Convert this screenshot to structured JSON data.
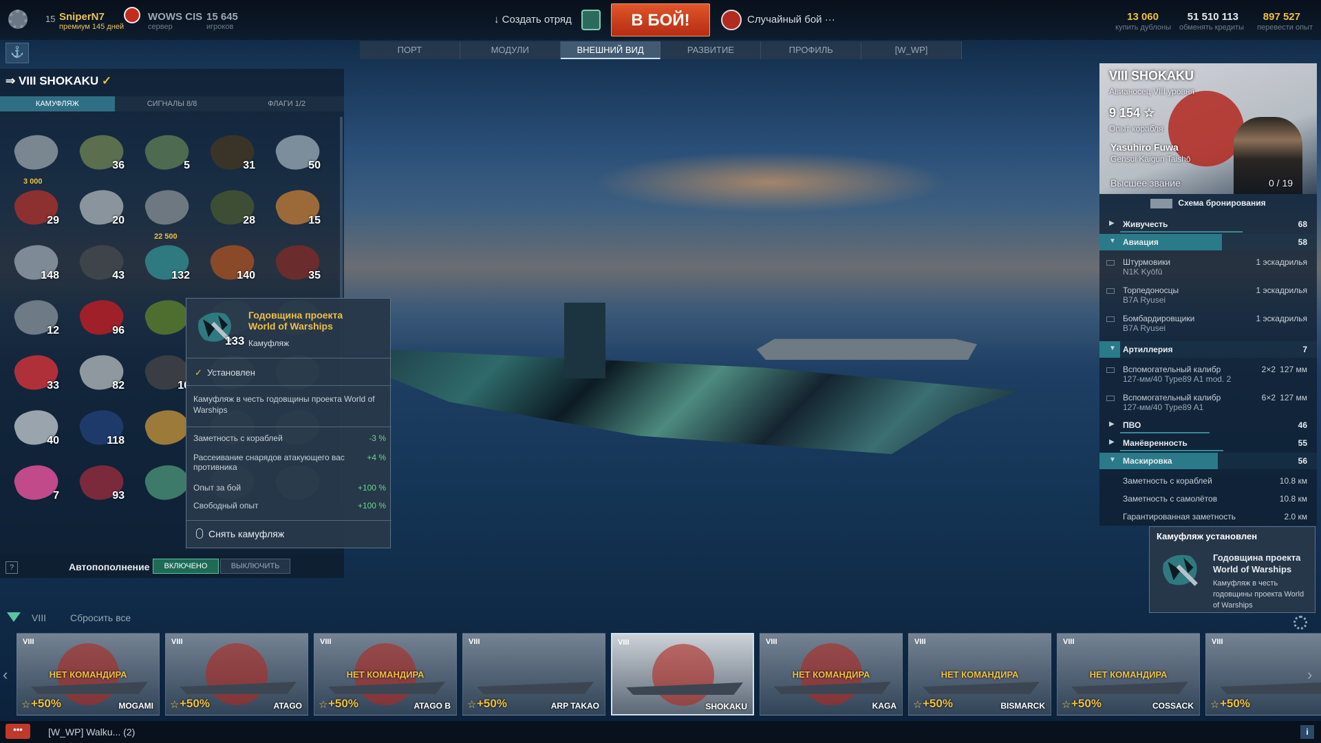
{
  "topbar": {
    "level": "15",
    "nickname": "SniperN7",
    "premium": "премиум 145 дней",
    "server": "WOWS CIS",
    "server_label": "сервер",
    "players": "15 645",
    "players_label": "игроков",
    "create_squad": "↓ Создать отряд",
    "battle": "В БОЙ!",
    "mode": "Случайный бой ···",
    "doubloons": "13 060",
    "doubloons_label": "купить дублоны",
    "credits": "51 510 113",
    "credits_label": "обменять кредиты",
    "free_xp": "897 527",
    "free_xp_label": "перевести опыт"
  },
  "nav": {
    "tabs": [
      "ПОРТ",
      "МОДУЛИ",
      "ВНЕШНИЙ ВИД",
      "РАЗВИТИЕ",
      "ПРОФИЛЬ",
      "[W_WP]"
    ],
    "active": 2
  },
  "left_panel": {
    "ship": "VIII SHOKAKU",
    "tabs": [
      "КАМУФЛЯЖ",
      "СИГНАЛЫ 8/8",
      "ФЛАГИ 1/2"
    ],
    "camos": [
      {
        "count": "",
        "price": "3 000",
        "color": "#7a8690"
      },
      {
        "count": "36",
        "price": "",
        "color": "#5b6e4e"
      },
      {
        "count": "5",
        "price": "",
        "color": "#4e6a50"
      },
      {
        "count": "31",
        "price": "",
        "color": "#3a3428"
      },
      {
        "count": "50",
        "price": "",
        "color": "#7c8e9c"
      },
      {
        "count": "29",
        "price": "",
        "color": "#8c3030"
      },
      {
        "count": "20",
        "price": "",
        "color": "#8a949c"
      },
      {
        "count": "",
        "price": "22 500",
        "color": "#6e7880"
      },
      {
        "count": "28",
        "price": "",
        "color": "#3e4e34"
      },
      {
        "count": "15",
        "price": "",
        "color": "#9c6a38"
      },
      {
        "count": "148",
        "price": "",
        "color": "#7e8a96"
      },
      {
        "count": "43",
        "price": "",
        "color": "#3e444a"
      },
      {
        "count": "132",
        "price": "",
        "color": "#2e7a80"
      },
      {
        "count": "140",
        "price": "",
        "color": "#8a4a2a"
      },
      {
        "count": "35",
        "price": "",
        "color": "#6a2c2c"
      },
      {
        "count": "12",
        "price": "",
        "color": "#6e7a86"
      },
      {
        "count": "96",
        "price": "",
        "color": "#a0202a"
      },
      {
        "count": "",
        "price": "",
        "color": "#4e6e30"
      },
      {
        "count": "",
        "price": "",
        "color": "#6e7a86"
      },
      {
        "count": "",
        "price": "",
        "color": "#6e7a86"
      },
      {
        "count": "33",
        "price": "",
        "color": "#b0303a"
      },
      {
        "count": "82",
        "price": "",
        "color": "#8e989e"
      },
      {
        "count": "10",
        "price": "",
        "color": "#3a3e44"
      },
      {
        "count": "",
        "price": "",
        "color": "#6e7a86"
      },
      {
        "count": "",
        "price": "",
        "color": "#6e7a86"
      },
      {
        "count": "40",
        "price": "",
        "color": "#9aa4ac"
      },
      {
        "count": "118",
        "price": "",
        "color": "#1e3a6a"
      },
      {
        "count": "",
        "price": "",
        "color": "#9c7a3a"
      },
      {
        "count": "",
        "price": "",
        "color": "#6e7a86"
      },
      {
        "count": "",
        "price": "",
        "color": "#6e7a86"
      },
      {
        "count": "7",
        "price": "",
        "color": "#c04a8a"
      },
      {
        "count": "93",
        "price": "",
        "color": "#7a2a3a"
      },
      {
        "count": "",
        "price": "",
        "color": "#3e7a6a"
      },
      {
        "count": "",
        "price": "",
        "color": "#6e7a86"
      },
      {
        "count": "",
        "price": "",
        "color": "#6e7a86"
      }
    ],
    "autofill_label": "Автопополнение",
    "autofill_on": "ВКЛЮЧЕНО",
    "autofill_off": "ВЫКЛЮЧИТЬ"
  },
  "tooltip": {
    "title1": "Годовщина проекта",
    "title2": "World of Warships",
    "count": "133",
    "type": "Камуфляж",
    "installed": "Установлен",
    "desc": "Камуфляж в честь годовщины проекта World of Warships",
    "stats": [
      {
        "name": "Заметность с кораблей",
        "value": "-3 %"
      },
      {
        "name": "Рассеивание снарядов атакующего вас противника",
        "value": "+4 %"
      },
      {
        "name": "Опыт за бой",
        "value": "+100 %"
      },
      {
        "name": "Свободный опыт",
        "value": "+100 %"
      }
    ],
    "remove": "Снять камуфляж"
  },
  "right_panel": {
    "name": "VIII SHOKAKU",
    "subtitle": "Авианосец VIII уровня",
    "xp": "9 154 ☆",
    "xp_label": "Опыт корабля",
    "commander": "Yasuhiro Fuwa",
    "commander_sub": "Gensui Kaigun Taishō",
    "rank": "Высшее звание",
    "points": "0 / 19",
    "armor": "Схема бронирования",
    "sections": {
      "hp": {
        "name": "Живучесть",
        "value": "68"
      },
      "air": {
        "name": "Авиация",
        "value": "58"
      },
      "art": {
        "name": "Артиллерия",
        "value": "7"
      },
      "aa": {
        "name": "ПВО",
        "value": "46"
      },
      "man": {
        "name": "Манёвренность",
        "value": "55"
      },
      "con": {
        "name": "Маскировка",
        "value": "56"
      }
    },
    "aviation": [
      {
        "n1": "Штурмовики",
        "n2": "N1K Kyōfū",
        "q": "1 эскадрилья"
      },
      {
        "n1": "Торпедоносцы",
        "n2": "B7A Ryusei",
        "q": "1 эскадрилья"
      },
      {
        "n1": "Бомбардировщики",
        "n2": "B7A Ryusei",
        "q": "1 эскадрилья"
      }
    ],
    "artillery": [
      {
        "n1": "Вспомогательный калибр",
        "n2": "127-мм/40 Type89 A1 mod. 2",
        "q2": "2×2",
        "q": "127 мм"
      },
      {
        "n1": "Вспомогательный калибр",
        "n2": "127-мм/40 Type89 A1",
        "q2": "6×2",
        "q": "127 мм"
      }
    ],
    "concealment": [
      {
        "name": "Заметность с кораблей",
        "value": "10.8 км"
      },
      {
        "name": "Заметность с самолётов",
        "value": "10.8 км"
      },
      {
        "name": "Гарантированная заметность",
        "value": "2.0 км"
      }
    ]
  },
  "notification": {
    "header": "Камуфляж установлен",
    "title1": "Годовщина проекта",
    "title2": "World of Warships",
    "desc": "Камуфляж в честь годовщины проекта World of Warships"
  },
  "filter": {
    "tier": "VIII",
    "reset": "Сбросить все"
  },
  "carousel": [
    {
      "tier": "VIII",
      "status": "НЕТ КОМАНДИРА",
      "bonus": "+50%",
      "name": "MOGAMI",
      "sun": true
    },
    {
      "tier": "VIII",
      "status": "",
      "bonus": "+50%",
      "name": "ATAGO",
      "sun": true
    },
    {
      "tier": "VIII",
      "status": "НЕТ КОМАНДИРА",
      "bonus": "+50%",
      "name": "ATAGO B",
      "sun": true
    },
    {
      "tier": "VIII",
      "status": "",
      "bonus": "+50%",
      "name": "ARP TAKAO",
      "sun": false
    },
    {
      "tier": "VIII",
      "status": "",
      "bonus": "",
      "name": "SHOKAKU",
      "sun": true
    },
    {
      "tier": "VIII",
      "status": "НЕТ КОМАНДИРА",
      "bonus": "",
      "name": "KAGA",
      "sun": true
    },
    {
      "tier": "VIII",
      "status": "НЕТ КОМАНДИРА",
      "bonus": "+50%",
      "name": "BISMARCK",
      "sun": false
    },
    {
      "tier": "VIII",
      "status": "НЕТ КОМАНДИРА",
      "bonus": "+50%",
      "name": "COSSACK",
      "sun": false
    },
    {
      "tier": "VIII",
      "status": "",
      "bonus": "+50%",
      "name": "",
      "sun": false
    }
  ],
  "bottom": {
    "chat": "[W_WP] Walku...  (2)",
    "menu": "•••"
  },
  "colors": {
    "accent": "#f0c040",
    "battle": "#d2461f",
    "active_teal": "#2f6f85"
  }
}
